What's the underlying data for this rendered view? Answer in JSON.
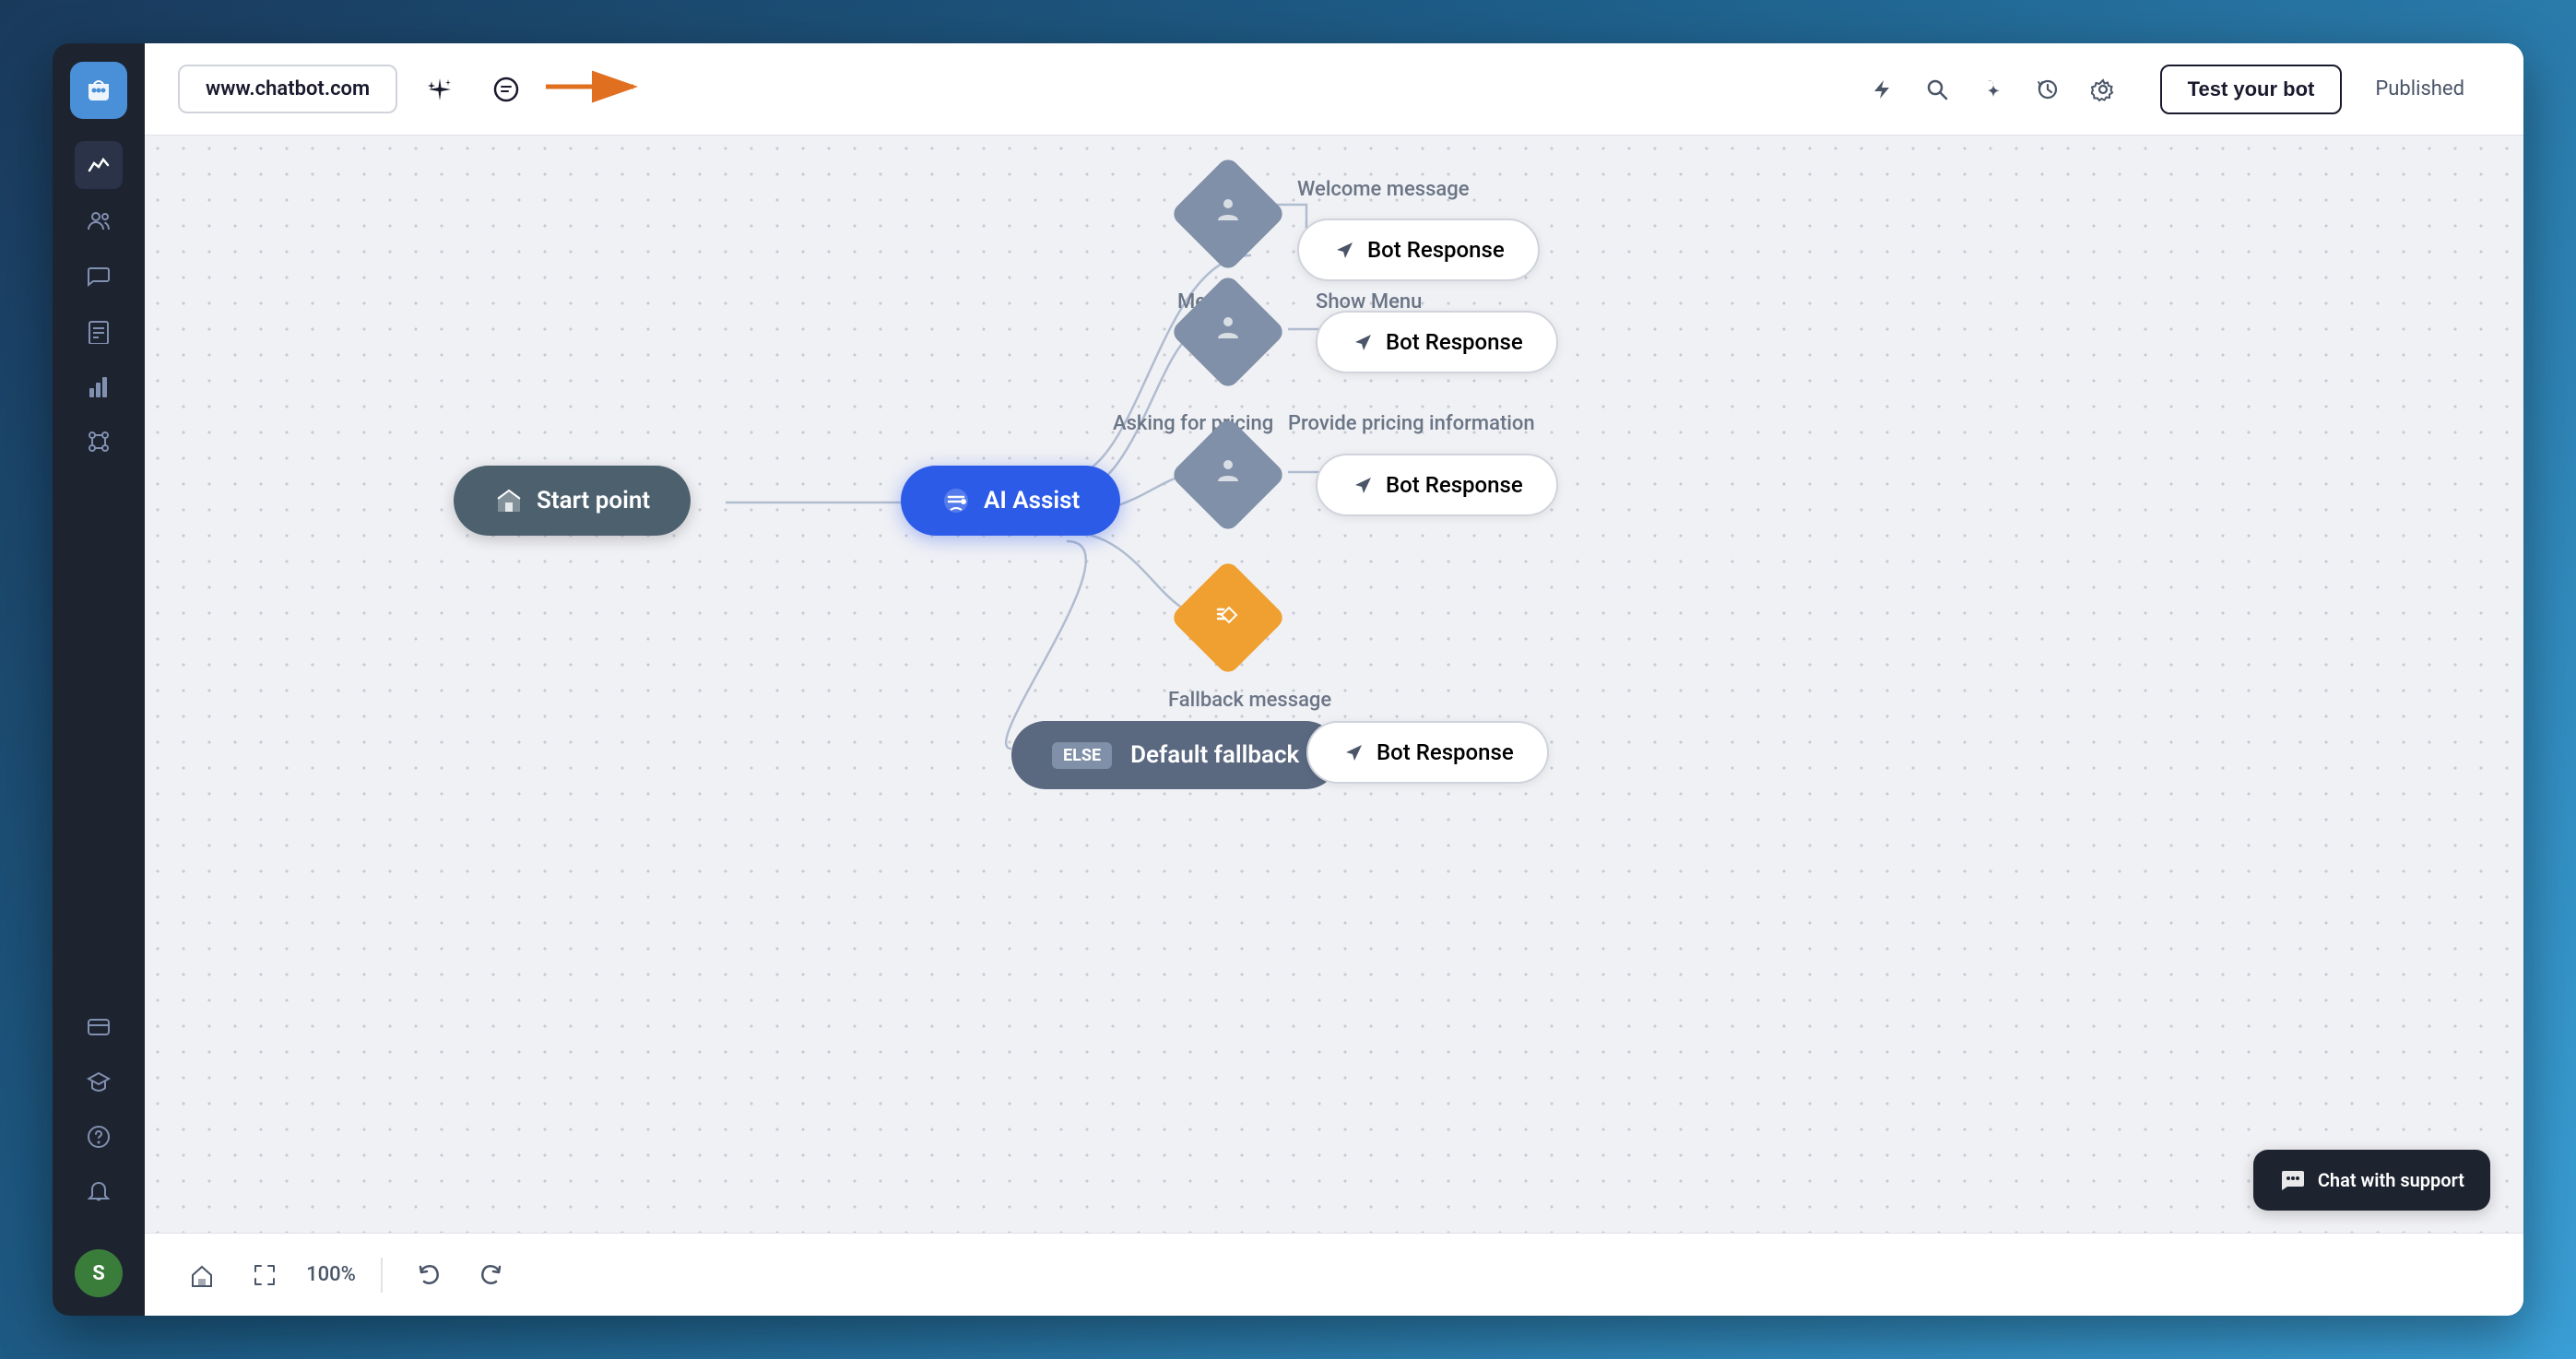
{
  "app": {
    "logo_icon": "💬",
    "logo_label": "Chatbot"
  },
  "sidebar": {
    "items": [
      {
        "icon": "⚡",
        "label": "activity",
        "active": true
      },
      {
        "icon": "👤",
        "label": "users"
      },
      {
        "icon": "💬",
        "label": "conversations"
      },
      {
        "icon": "📋",
        "label": "reports"
      },
      {
        "icon": "📊",
        "label": "analytics"
      },
      {
        "icon": "🔌",
        "label": "integrations"
      },
      {
        "icon": "💳",
        "label": "billing"
      },
      {
        "icon": "🎓",
        "label": "academy"
      },
      {
        "icon": "❓",
        "label": "help"
      },
      {
        "icon": "🔔",
        "label": "notifications"
      }
    ],
    "avatar_label": "S"
  },
  "topbar": {
    "url": "www.chatbot.com",
    "sparkle_icon": "✦",
    "chat_icon": "💬",
    "arrow_label": "→",
    "icons": [
      {
        "id": "flash",
        "icon": "⚡",
        "label": "flash"
      },
      {
        "id": "search",
        "icon": "🔍",
        "label": "search"
      },
      {
        "id": "magic",
        "icon": "⚡",
        "label": "magic"
      },
      {
        "id": "history",
        "icon": "🕐",
        "label": "history"
      },
      {
        "id": "settings",
        "icon": "⚙",
        "label": "settings"
      }
    ],
    "test_bot_label": "Test your bot",
    "published_label": "Published"
  },
  "canvas": {
    "nodes": {
      "start_point": {
        "label": "Start point",
        "icon": "🏠"
      },
      "ai_assist": {
        "label": "AI Assist",
        "icon": "💬"
      },
      "welcome_label": "Welcome message",
      "bot_response_welcome": "Bot Response",
      "menu_label": "Menu",
      "show_menu_label": "Show Menu",
      "bot_response_menu": "Bot Response",
      "asking_pricing_label": "Asking for pricing",
      "provide_pricing_label": "Provide pricing information",
      "bot_response_pricing": "Bot Response",
      "fallback_label": "Fallback message",
      "default_fallback": "Default fallback",
      "bot_response_fallback": "Bot Response",
      "else_badge": "ELSE"
    }
  },
  "bottombar": {
    "home_icon": "🏠",
    "expand_icon": "⤢",
    "zoom": "100%",
    "undo_icon": "↩",
    "redo_icon": "↪"
  },
  "chat_support": {
    "icon": "💬",
    "label": "Chat with support"
  }
}
